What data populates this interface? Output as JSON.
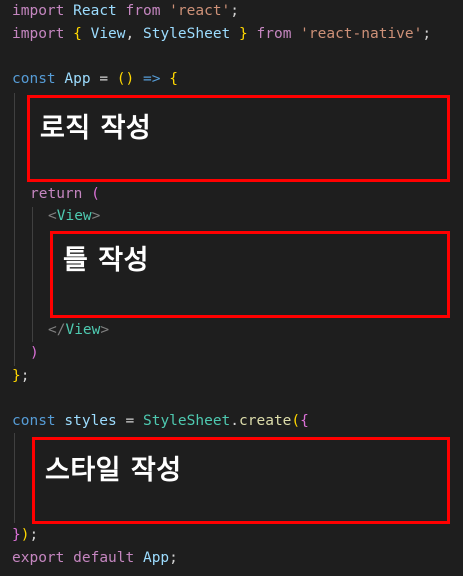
{
  "code": {
    "l1": {
      "import": "import",
      "name": "React",
      "from": "from",
      "module": "'react'",
      "semi": ";"
    },
    "l2": {
      "import": "import",
      "open": "{",
      "name1": "View",
      "comma": ",",
      "name2": "StyleSheet",
      "close": "}",
      "from": "from",
      "module": "'react-native'",
      "semi": ";"
    },
    "l4": {
      "const": "const",
      "name": "App",
      "eq": "=",
      "paren": "()",
      "arrow": "=>",
      "brace": "{"
    },
    "l8": {
      "return": "return",
      "paren": "("
    },
    "l9": {
      "open": "<",
      "tag": "View",
      "close": ">"
    },
    "l13": {
      "open": "</",
      "tag": "View",
      "close": ">"
    },
    "l14": {
      "paren": ")"
    },
    "l15": {
      "brace": "}",
      "semi": ";"
    },
    "l17": {
      "const": "const",
      "name": "styles",
      "eq": "=",
      "cls": "StyleSheet",
      "dot": ".",
      "fn": "create",
      "paren": "(",
      "brace": "{"
    },
    "l21": {
      "brace": "}",
      "paren": ")",
      "semi": ";"
    },
    "l22": {
      "export": "export",
      "default": "default",
      "name": "App",
      "semi": ";"
    }
  },
  "annotations": {
    "logic": "로직 작성",
    "frame": "틀 작성",
    "style": "스타일 작성"
  },
  "colors": {
    "background": "#1e1e1e",
    "annotation_border": "#ff0000",
    "annotation_text": "#ffffff"
  }
}
